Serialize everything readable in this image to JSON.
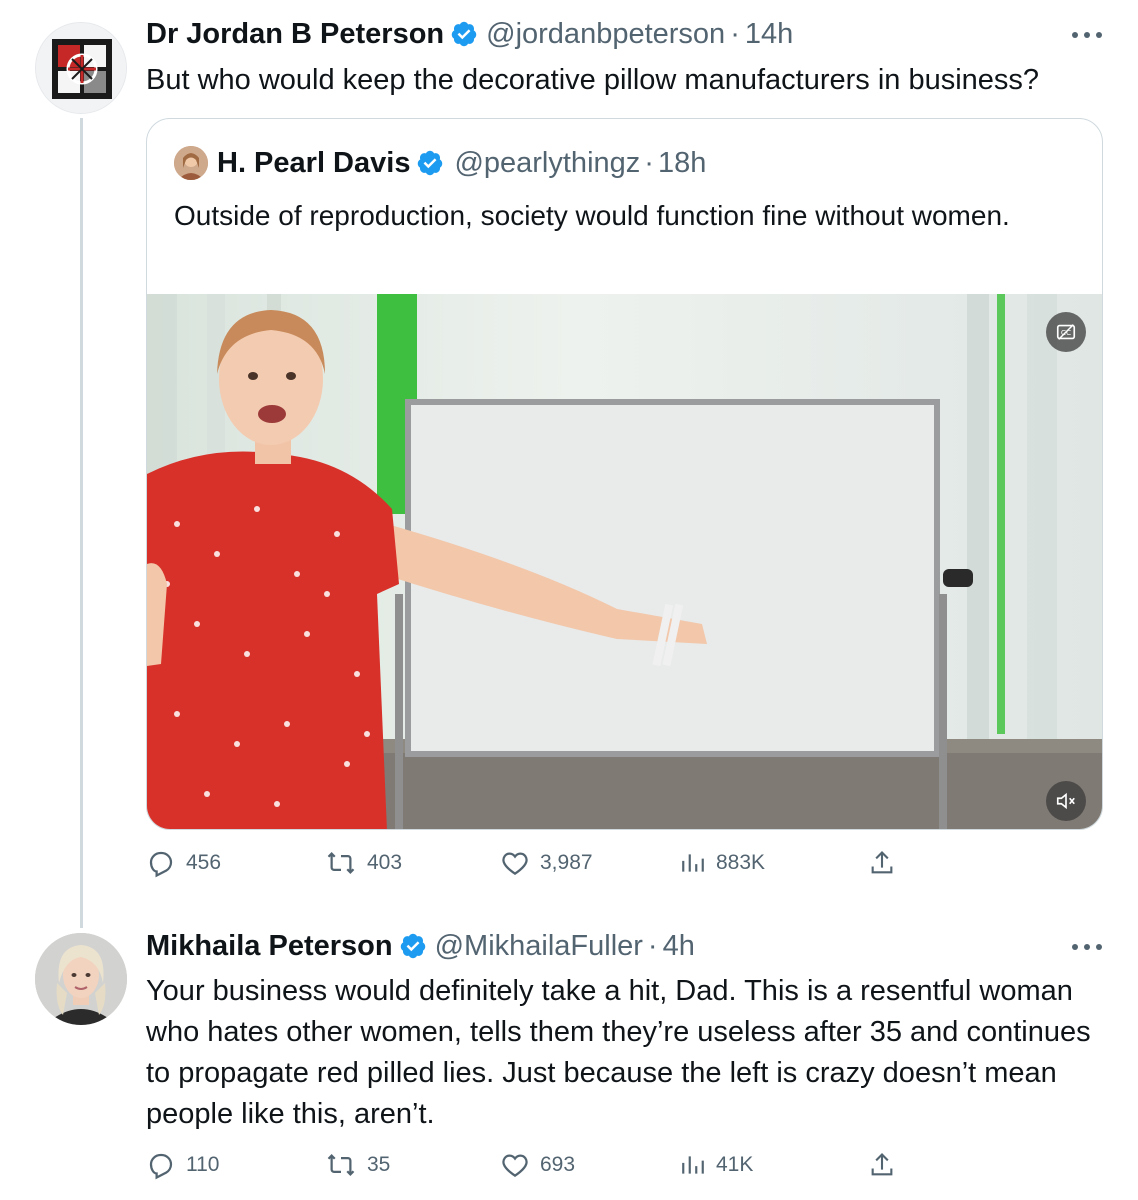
{
  "tweet1": {
    "name": "Dr Jordan B Peterson",
    "handle": "@jordanbpeterson",
    "dot": "·",
    "time": "14h",
    "text": "But who would keep the decorative pillow manufacturers in business?",
    "quote": {
      "name": "H. Pearl Davis",
      "handle": "@pearlythingz",
      "dot": "·",
      "time": "18h",
      "text": "Outside of reproduction, society would function fine without women."
    },
    "stats": {
      "replies": "456",
      "retweets": "403",
      "likes": "3,987",
      "views": "883K"
    }
  },
  "tweet2": {
    "name": "Mikhaila Peterson",
    "handle": "@MikhailaFuller",
    "dot": "·",
    "time": "4h",
    "text": "Your business would definitely take a hit, Dad. This is a resentful woman who hates other women, tells them they’re useless after 35 and continues to propagate red pilled lies. Just because the left is crazy doesn’t mean people like this, aren’t.",
    "stats": {
      "replies": "110",
      "retweets": "35",
      "likes": "693",
      "views": "41K"
    }
  },
  "icons": {
    "verified": "verified-badge-icon",
    "reply": "reply-icon",
    "retweet": "retweet-icon",
    "like": "heart-icon",
    "views": "views-icon",
    "share": "share-icon",
    "more": "more-icon",
    "captions": "captions-icon",
    "mute": "mute-icon"
  },
  "colors": {
    "accent": "#1d9bf0",
    "secondary_text": "#536471",
    "border": "#cfd9de"
  }
}
